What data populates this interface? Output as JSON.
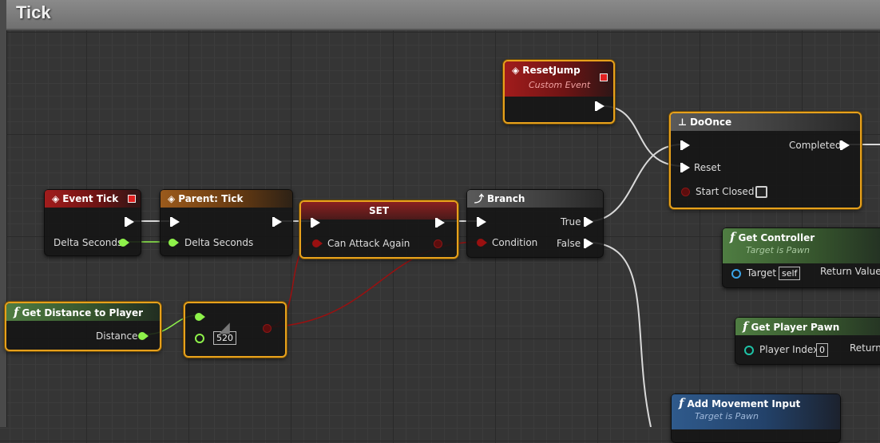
{
  "graph": {
    "title": "Tick"
  },
  "nodes": {
    "event_tick": {
      "title": "Event Tick",
      "out_delta": "Delta Seconds"
    },
    "parent_tick": {
      "title": "Parent: Tick",
      "in_delta": "Delta Seconds"
    },
    "set_node": {
      "title": "SET",
      "input_label": "Can Attack Again"
    },
    "branch": {
      "title": "Branch",
      "condition": "Condition",
      "true_label": "True",
      "false_label": "False"
    },
    "reset_jump": {
      "title": "ResetJump",
      "subtitle": "Custom Event"
    },
    "do_once": {
      "title": "DoOnce",
      "completed": "Completed",
      "reset": "Reset",
      "start_closed": "Start Closed"
    },
    "get_distance": {
      "title": "Get Distance to Player",
      "out_label": "Distance"
    },
    "compare": {
      "value": "520"
    },
    "get_controller": {
      "title": "Get Controller",
      "subtitle": "Target is Pawn",
      "target_label": "Target",
      "target_value": "self",
      "return_label": "Return Value"
    },
    "get_player_pawn": {
      "title": "Get Player Pawn",
      "index_label": "Player Index",
      "index_value": "0",
      "return_label": "Return"
    },
    "add_movement": {
      "title": "Add Movement Input",
      "subtitle": "Target is Pawn"
    }
  },
  "colors": {
    "selection": "#e7a11c",
    "exec_wire": "#d9d9d9",
    "float_wire": "#8ef24a",
    "bool_wire": "#9a1010"
  }
}
